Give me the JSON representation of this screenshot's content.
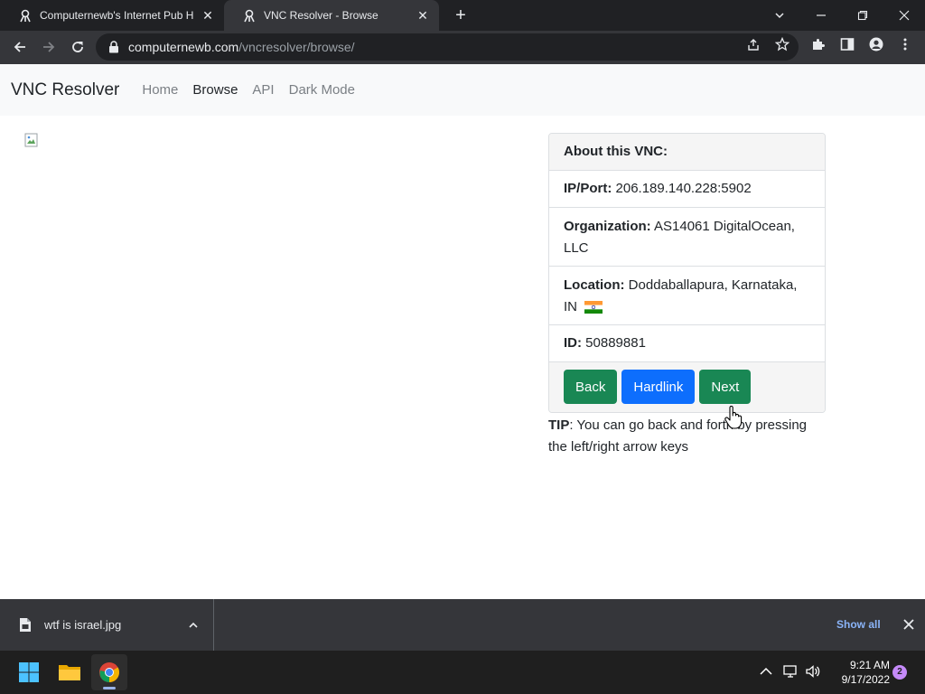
{
  "browser": {
    "tabs": [
      {
        "title": "Computernewb's Internet Pub H",
        "active": false
      },
      {
        "title": "VNC Resolver - Browse",
        "active": true
      }
    ],
    "url": {
      "host": "computernewb.com",
      "path": "/vncresolver/browse/"
    }
  },
  "site": {
    "brand": "VNC Resolver",
    "nav": [
      {
        "label": "Home",
        "active": false
      },
      {
        "label": "Browse",
        "active": true
      },
      {
        "label": "API",
        "active": false
      },
      {
        "label": "Dark Mode",
        "active": false
      }
    ]
  },
  "card": {
    "header": "About this VNC:",
    "ip_label": "IP/Port:",
    "ip_value": "206.189.140.228:5902",
    "org_label": "Organization:",
    "org_value": "AS14061 DigitalOcean, LLC",
    "loc_label": "Location:",
    "loc_value": "Doddaballapura, Karnataka, IN",
    "id_label": "ID:",
    "id_value": "50889881",
    "buttons": {
      "back": "Back",
      "hardlink": "Hardlink",
      "next": "Next"
    }
  },
  "tip": {
    "label": "TIP",
    "text": ": You can go back and forth by pressing the left/right arrow keys"
  },
  "downloads": {
    "file": "wtf is israel.jpg",
    "show_all": "Show all"
  },
  "taskbar": {
    "time": "9:21 AM",
    "date": "9/17/2022",
    "notifications": "2"
  },
  "colors": {
    "green_button": "#198754",
    "blue_button": "#0d6efd",
    "navbar_bg": "#f8f9fa"
  }
}
